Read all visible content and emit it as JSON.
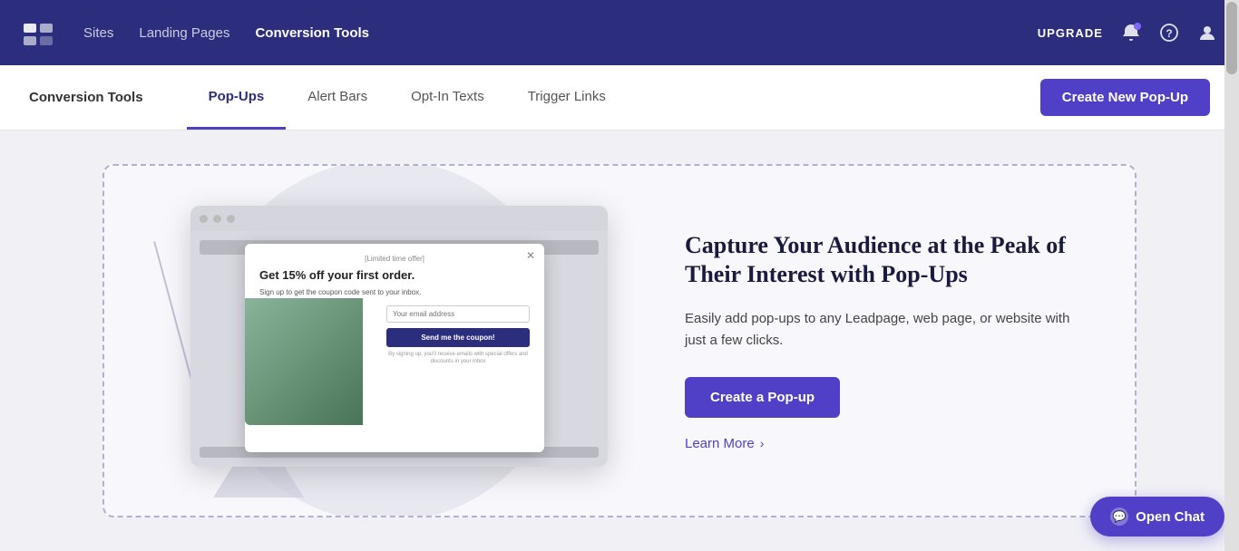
{
  "topNav": {
    "links": [
      {
        "label": "Sites",
        "active": false
      },
      {
        "label": "Landing Pages",
        "active": false
      },
      {
        "label": "Conversion Tools",
        "active": true
      }
    ],
    "upgradeLabel": "UPGRADE",
    "notificationDot": true
  },
  "subNav": {
    "title": "Conversion Tools",
    "tabs": [
      {
        "label": "Pop-Ups",
        "active": true
      },
      {
        "label": "Alert Bars",
        "active": false
      },
      {
        "label": "Opt-In Texts",
        "active": false
      },
      {
        "label": "Trigger Links",
        "active": false
      }
    ],
    "createButtonLabel": "Create New Pop-Up"
  },
  "featureSection": {
    "headline": "Capture Your Audience at the Peak of Their Interest with Pop-Ups",
    "description": "Easily add pop-ups to any Leadpage, web page, or website with just a few clicks.",
    "ctaLabel": "Create a Pop-up",
    "learnMoreLabel": "Learn More"
  },
  "popup": {
    "tag": "[Limited time offer]",
    "headline": "Get 15% off your first order.",
    "subtext": "Sign up to get the coupon code sent to your inbox.",
    "emailPlaceholder": "Your email address",
    "ctaLabel": "Send me the coupon!",
    "finePrint": "By signing up, you'll receive emails with special offers and discounts in your inbox"
  },
  "chat": {
    "label": "Open Chat"
  }
}
